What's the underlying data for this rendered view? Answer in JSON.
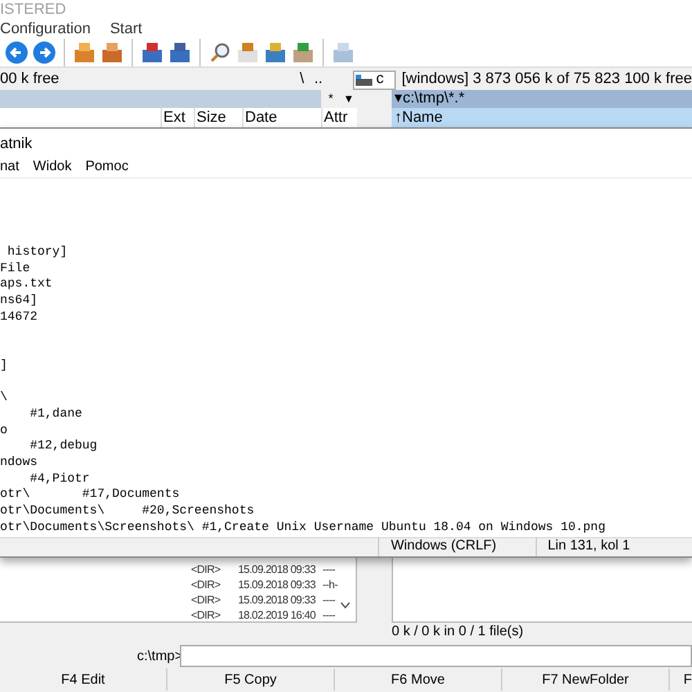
{
  "window": {
    "title": "ISTERED"
  },
  "menu": [
    "Configuration",
    "Start"
  ],
  "left_panel": {
    "drive_info": "00 k free",
    "root_button": "\\",
    "up_button": "..",
    "star_button": "*",
    "history_button": "▼",
    "columns": [
      "Ext",
      "Size",
      "Date",
      "Attr"
    ],
    "rows": [
      {
        "size": "<DIR>",
        "date": "15.09.2018 09:33",
        "attr": "----"
      },
      {
        "size": "<DIR>",
        "date": "15.09.2018 09:33",
        "attr": "--h-"
      },
      {
        "size": "<DIR>",
        "date": "15.09.2018 09:33",
        "attr": "----"
      },
      {
        "size": "<DIR>",
        "date": "18.02.2019 16:40",
        "attr": "----"
      }
    ]
  },
  "right_panel": {
    "drive": "c",
    "drive_info": "[windows]  3 873 056 k of 75 823 100 k free",
    "path": "▾c:\\tmp\\*.*",
    "column": "↑Name",
    "status": "0 k / 0 k in 0 / 1 file(s)"
  },
  "notepad": {
    "title": "atnik",
    "menu": [
      "nat",
      "Widok",
      "Pomoc"
    ],
    "text": "\n\n\n\n history]\nFile\naps.txt\nns64]\n14672\n\n\n]\n\n\\\n    #1,dane\no\n    #12,debug\nndows\n    #4,Piotr\notr\\       #17,Documents\notr\\Documents\\     #20,Screenshots\notr\\Documents\\Screenshots\\ #1,Create Unix Username Ubuntu 18.04 on Windows 10.png",
    "status": [
      "Windows (CRLF)",
      "Lin 131, kol 1"
    ]
  },
  "command_line": {
    "prompt": "c:\\tmp>"
  },
  "function_keys": [
    "F4 Edit",
    "F5 Copy",
    "F6 Move",
    "F7 NewFolder",
    "F"
  ]
}
